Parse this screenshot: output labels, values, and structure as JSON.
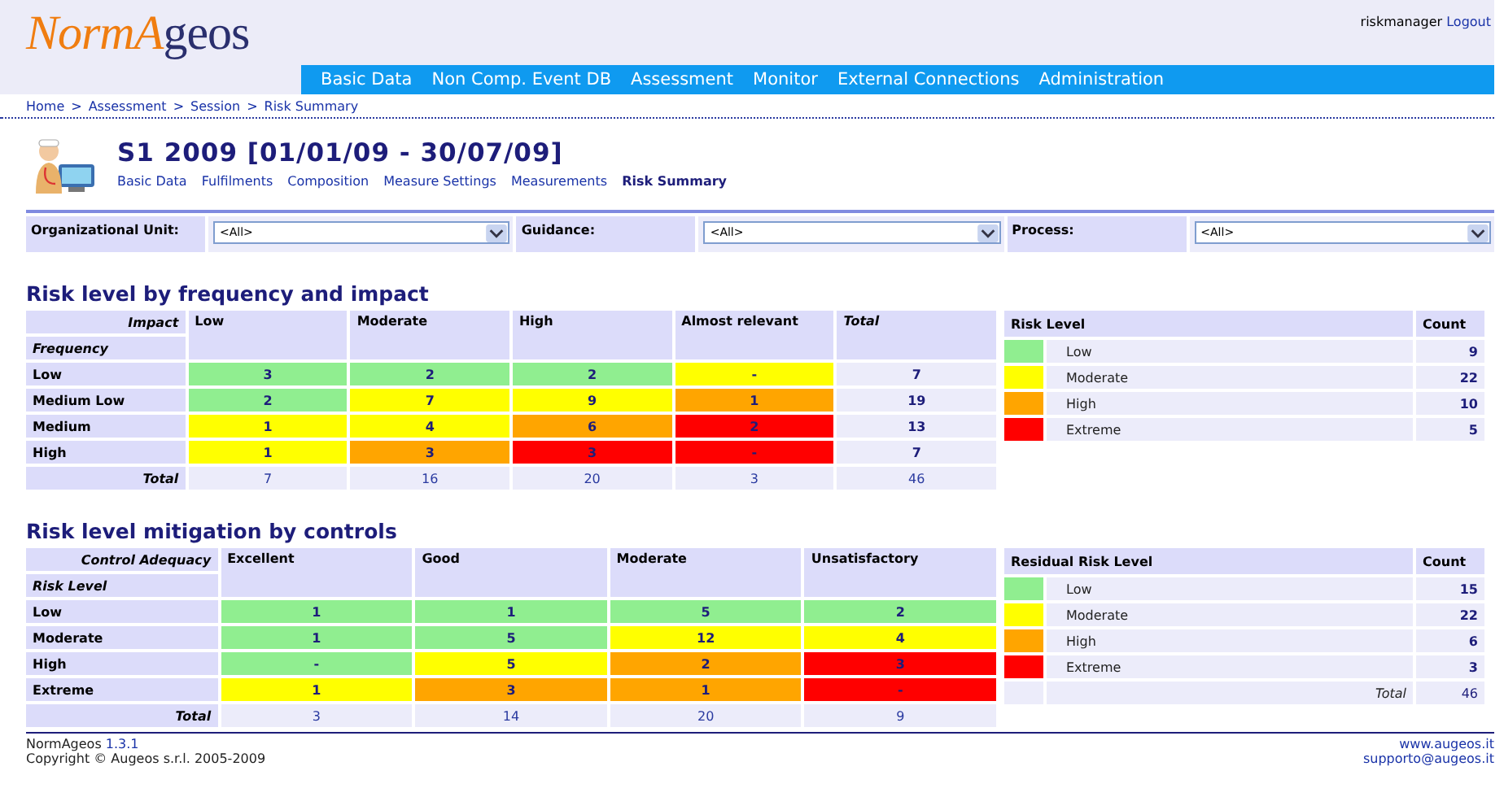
{
  "logo": {
    "accent": "NormA",
    "rest": "geos"
  },
  "user": {
    "name": "riskmanager",
    "logout": "Logout"
  },
  "nav": [
    "Basic Data",
    "Non Comp. Event DB",
    "Assessment",
    "Monitor",
    "External Connections",
    "Administration"
  ],
  "breadcrumb": [
    "Home",
    "Assessment",
    "Session",
    "Risk Summary"
  ],
  "breadcrumb_separator": ">",
  "title": "S1 2009 [01/01/09 - 30/07/09]",
  "subtabs": [
    {
      "label": "Basic Data",
      "selected": false
    },
    {
      "label": "Fulfilments",
      "selected": false
    },
    {
      "label": "Composition",
      "selected": false
    },
    {
      "label": "Measure Settings",
      "selected": false
    },
    {
      "label": "Measurements",
      "selected": false
    },
    {
      "label": "Risk Summary",
      "selected": true
    }
  ],
  "filters": [
    {
      "label": "Organizational Unit:",
      "value": "<All>"
    },
    {
      "label": "Guidance:",
      "value": "<All>"
    },
    {
      "label": "Process:",
      "value": "<All>"
    }
  ],
  "sections": [
    {
      "heading": "Risk level by frequency and impact",
      "col_axis": "Impact",
      "row_axis": "Frequency",
      "columns": [
        "Low",
        "Moderate",
        "High",
        "Almost relevant"
      ],
      "total_column": "Total",
      "rows": [
        {
          "label": "Low",
          "total": "7",
          "cells": [
            {
              "value": "3",
              "color": "#90ee90"
            },
            {
              "value": "2",
              "color": "#90ee90"
            },
            {
              "value": "2",
              "color": "#90ee90"
            },
            {
              "value": "-",
              "color": "#ffff00"
            }
          ]
        },
        {
          "label": "Medium Low",
          "total": "19",
          "cells": [
            {
              "value": "2",
              "color": "#90ee90"
            },
            {
              "value": "7",
              "color": "#ffff00"
            },
            {
              "value": "9",
              "color": "#ffff00"
            },
            {
              "value": "1",
              "color": "#ffa500"
            }
          ]
        },
        {
          "label": "Medium",
          "total": "13",
          "cells": [
            {
              "value": "1",
              "color": "#ffff00"
            },
            {
              "value": "4",
              "color": "#ffff00"
            },
            {
              "value": "6",
              "color": "#ffa500"
            },
            {
              "value": "2",
              "color": "#ff0000"
            }
          ]
        },
        {
          "label": "High",
          "total": "7",
          "cells": [
            {
              "value": "1",
              "color": "#ffff00"
            },
            {
              "value": "3",
              "color": "#ffa500"
            },
            {
              "value": "3",
              "color": "#ff0000"
            },
            {
              "value": "-",
              "color": "#ff0000"
            }
          ]
        }
      ],
      "totals_label": "Total",
      "totals": [
        "7",
        "16",
        "20",
        "3",
        "46"
      ],
      "legend": {
        "heading": "Risk Level",
        "count_heading": "Count",
        "items": [
          {
            "label": "Low",
            "count": "9",
            "color": "#90ee90"
          },
          {
            "label": "Moderate",
            "count": "22",
            "color": "#ffff00"
          },
          {
            "label": "High",
            "count": "10",
            "color": "#ffa500"
          },
          {
            "label": "Extreme",
            "count": "5",
            "color": "#ff0000"
          }
        ]
      }
    },
    {
      "heading": "Risk level mitigation by controls",
      "col_axis": "Control Adequacy",
      "row_axis": "Risk Level",
      "columns": [
        "Excellent",
        "Good",
        "Moderate",
        "Unsatisfactory"
      ],
      "rows": [
        {
          "label": "Low",
          "cells": [
            {
              "value": "1",
              "color": "#90ee90"
            },
            {
              "value": "1",
              "color": "#90ee90"
            },
            {
              "value": "5",
              "color": "#90ee90"
            },
            {
              "value": "2",
              "color": "#90ee90"
            }
          ]
        },
        {
          "label": "Moderate",
          "cells": [
            {
              "value": "1",
              "color": "#90ee90"
            },
            {
              "value": "5",
              "color": "#90ee90"
            },
            {
              "value": "12",
              "color": "#ffff00"
            },
            {
              "value": "4",
              "color": "#ffff00"
            }
          ]
        },
        {
          "label": "High",
          "cells": [
            {
              "value": "-",
              "color": "#90ee90"
            },
            {
              "value": "5",
              "color": "#ffff00"
            },
            {
              "value": "2",
              "color": "#ffa500"
            },
            {
              "value": "3",
              "color": "#ff0000"
            }
          ]
        },
        {
          "label": "Extreme",
          "cells": [
            {
              "value": "1",
              "color": "#ffff00"
            },
            {
              "value": "3",
              "color": "#ffa500"
            },
            {
              "value": "1",
              "color": "#ffa500"
            },
            {
              "value": "-",
              "color": "#ff0000"
            }
          ]
        }
      ],
      "totals_label": "Total",
      "totals": [
        "3",
        "14",
        "20",
        "9"
      ],
      "legend": {
        "heading": "Residual Risk Level",
        "count_heading": "Count",
        "items": [
          {
            "label": "Low",
            "count": "15",
            "color": "#90ee90"
          },
          {
            "label": "Moderate",
            "count": "22",
            "color": "#ffff00"
          },
          {
            "label": "High",
            "count": "6",
            "color": "#ffa500"
          },
          {
            "label": "Extreme",
            "count": "3",
            "color": "#ff0000"
          }
        ],
        "total_label": "Total",
        "total": "46"
      }
    }
  ],
  "footer": {
    "product": "NormAgeos",
    "version": "1.3.1",
    "copyright": "Copyright © Augeos s.r.l. 2005-2009",
    "links": [
      "www.augeos.it",
      "supporto@augeos.it"
    ]
  }
}
